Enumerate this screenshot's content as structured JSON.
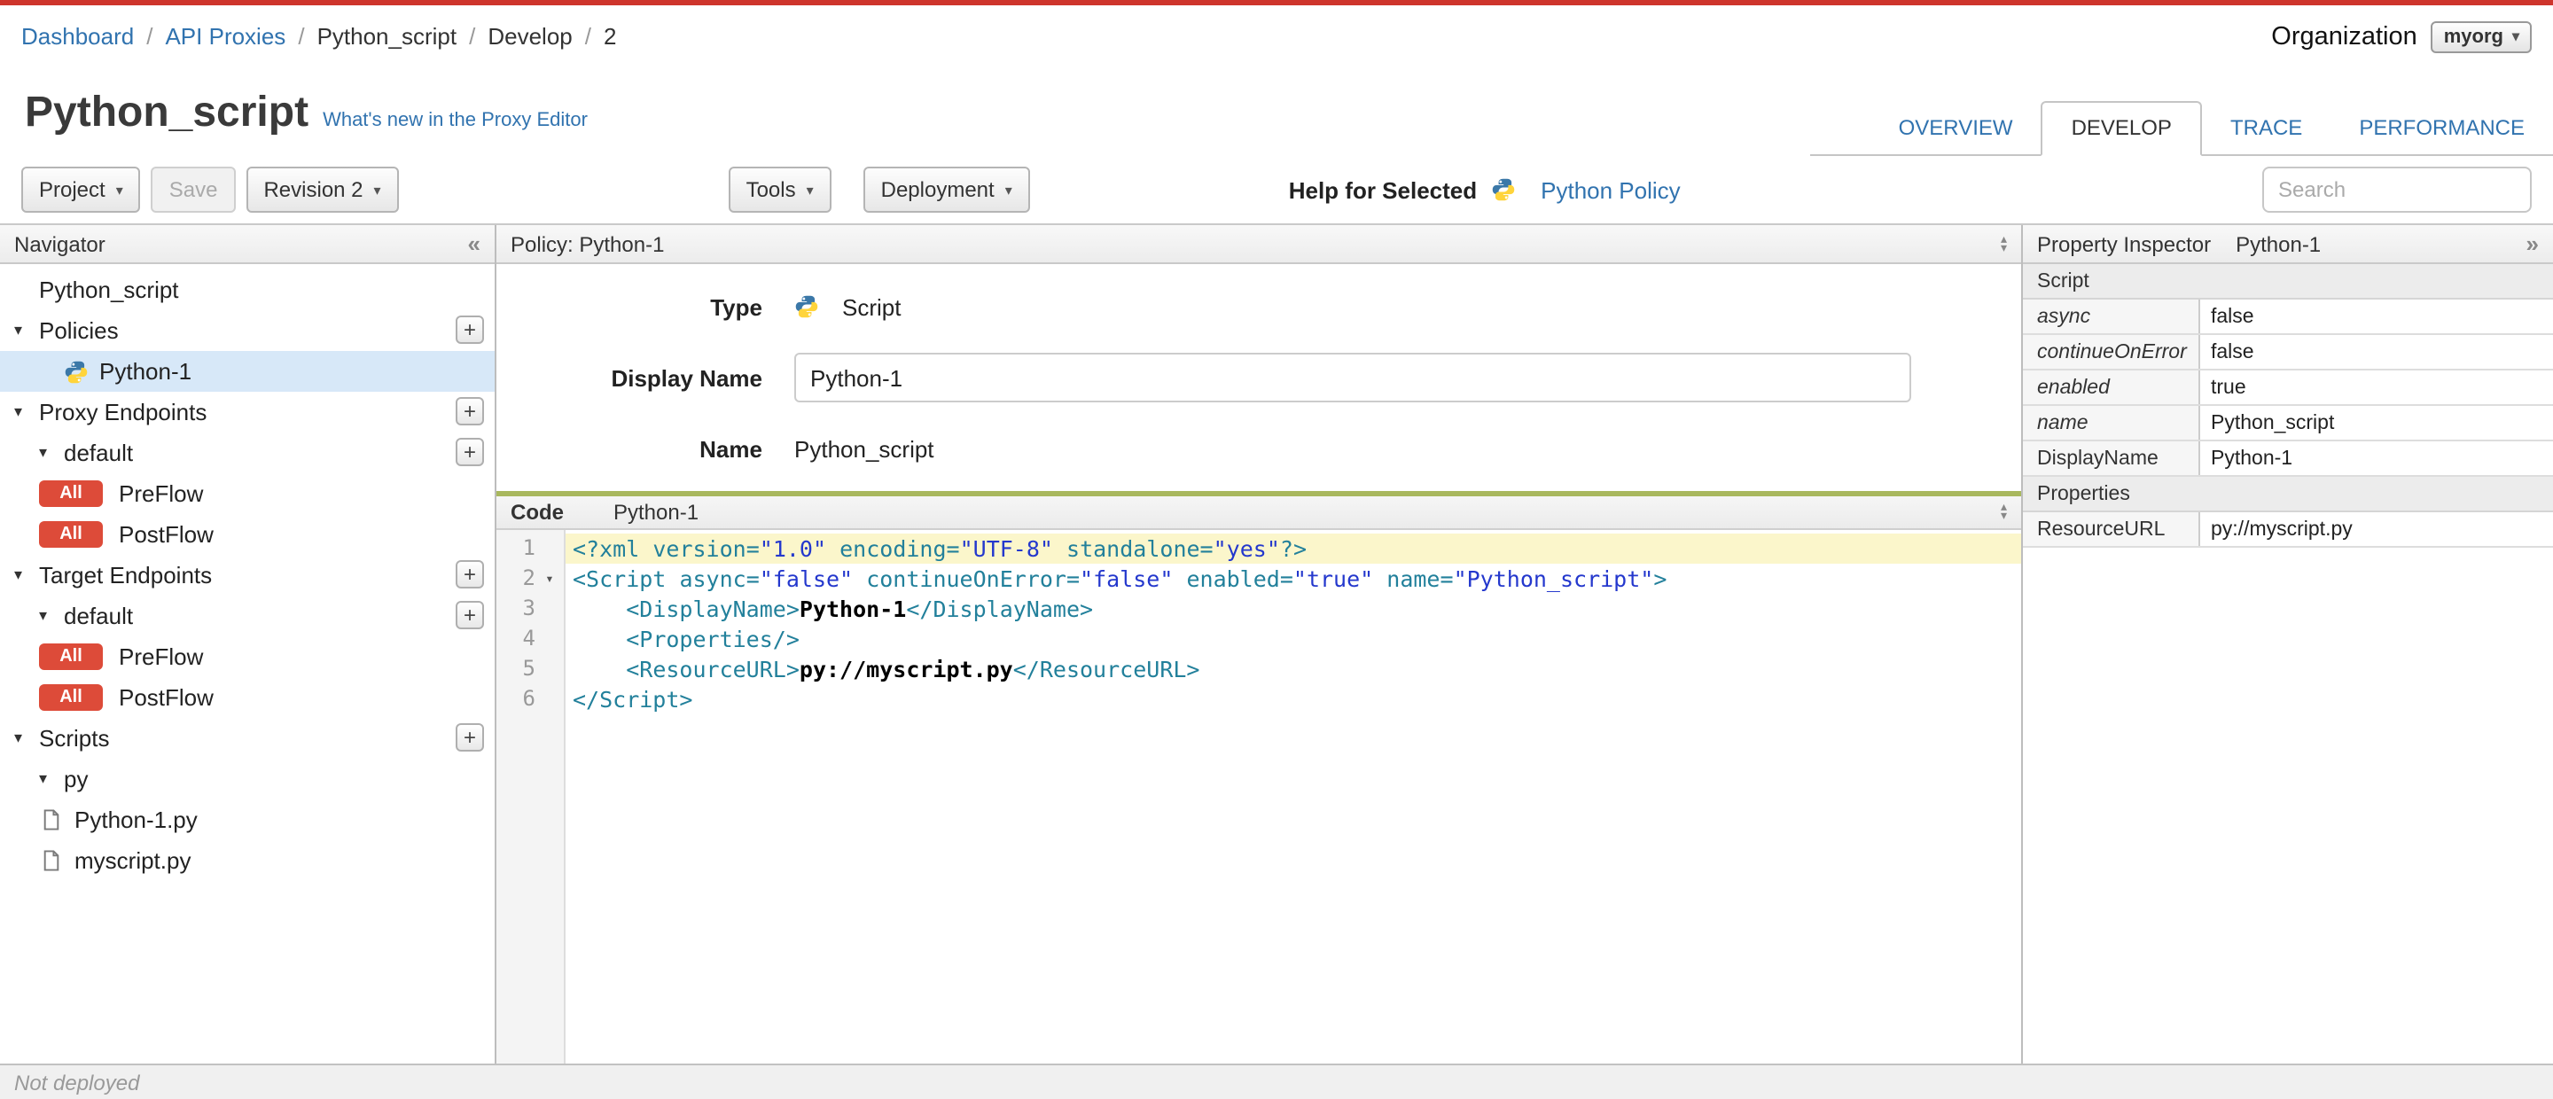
{
  "colors": {
    "accent-link": "#3173AF",
    "badge-red": "#DD4B39",
    "selected-row": "#D7E8F8",
    "code-divider-green": "#A9B85E",
    "top-stripe-red": "#CE352C",
    "active-line": "#FBF6CB",
    "tag-teal": "#22809B",
    "string-blue": "#2438CD"
  },
  "breadcrumb": {
    "items": [
      {
        "label": "Dashboard",
        "link": true
      },
      {
        "label": "API Proxies",
        "link": true
      },
      {
        "label": "Python_script",
        "link": false
      },
      {
        "label": "Develop",
        "link": false
      },
      {
        "label": "2",
        "link": false
      }
    ]
  },
  "organization": {
    "label": "Organization",
    "value": "myorg"
  },
  "header": {
    "title": "Python_script",
    "whats_new": "What's new in the Proxy Editor"
  },
  "tabs": [
    {
      "label": "OVERVIEW",
      "active": false
    },
    {
      "label": "DEVELOP",
      "active": true
    },
    {
      "label": "TRACE",
      "active": false
    },
    {
      "label": "PERFORMANCE",
      "active": false
    }
  ],
  "toolbar": {
    "project": "Project",
    "save": "Save",
    "revision": "Revision 2",
    "tools": "Tools",
    "deployment": "Deployment",
    "help_label": "Help for Selected",
    "help_link": "Python Policy",
    "search_placeholder": "Search"
  },
  "navigator": {
    "title": "Navigator",
    "collapse_icon": "«",
    "items": [
      {
        "label": "Python_script",
        "level": 0,
        "arrow": false,
        "pad": true
      },
      {
        "label": "Policies",
        "level": 0,
        "arrow": true,
        "plus": true
      },
      {
        "label": "Python-1",
        "level": 1,
        "arrow": false,
        "pad": true,
        "icon": "python",
        "selected": true
      },
      {
        "label": "Proxy Endpoints",
        "level": 0,
        "arrow": true,
        "plus": true
      },
      {
        "label": "default",
        "level": 1,
        "arrow": true,
        "plus": true
      },
      {
        "label": "PreFlow",
        "level": 1,
        "badge": "All"
      },
      {
        "label": "PostFlow",
        "level": 1,
        "badge": "All"
      },
      {
        "label": "Target Endpoints",
        "level": 0,
        "arrow": true,
        "plus": true
      },
      {
        "label": "default",
        "level": 1,
        "arrow": true,
        "plus": true
      },
      {
        "label": "PreFlow",
        "level": 1,
        "badge": "All"
      },
      {
        "label": "PostFlow",
        "level": 1,
        "badge": "All"
      },
      {
        "label": "Scripts",
        "level": 0,
        "arrow": true,
        "plus": true
      },
      {
        "label": "py",
        "level": 1,
        "arrow": true
      },
      {
        "label": "Python-1.py",
        "level": 1,
        "icon": "file"
      },
      {
        "label": "myscript.py",
        "level": 1,
        "icon": "file"
      }
    ]
  },
  "policy_panel": {
    "title": "Policy: Python-1",
    "type_label": "Type",
    "type_value": "Script",
    "display_name_label": "Display Name",
    "display_name_value": "Python-1",
    "name_label": "Name",
    "name_value": "Python_script"
  },
  "code_panel": {
    "label": "Code",
    "name": "Python-1",
    "lines": [
      {
        "num": 1,
        "active": true,
        "fold": false,
        "tokens": [
          [
            "tag",
            "<?xml"
          ],
          [
            "plain",
            " "
          ],
          [
            "attr",
            "version="
          ],
          [
            "str",
            "\"1.0\""
          ],
          [
            "plain",
            " "
          ],
          [
            "attr",
            "encoding="
          ],
          [
            "str",
            "\"UTF-8\""
          ],
          [
            "plain",
            " "
          ],
          [
            "attr",
            "standalone="
          ],
          [
            "str",
            "\"yes\""
          ],
          [
            "tag",
            "?>"
          ]
        ]
      },
      {
        "num": 2,
        "active": false,
        "fold": true,
        "tokens": [
          [
            "tag",
            "<Script"
          ],
          [
            "plain",
            " "
          ],
          [
            "attr",
            "async="
          ],
          [
            "str",
            "\"false\""
          ],
          [
            "plain",
            " "
          ],
          [
            "attr",
            "continueOnError="
          ],
          [
            "str",
            "\"false\""
          ],
          [
            "plain",
            " "
          ],
          [
            "attr",
            "enabled="
          ],
          [
            "str",
            "\"true\""
          ],
          [
            "plain",
            " "
          ],
          [
            "attr",
            "name="
          ],
          [
            "str",
            "\"Python_script\""
          ],
          [
            "tag",
            ">"
          ]
        ]
      },
      {
        "num": 3,
        "active": false,
        "fold": false,
        "tokens": [
          [
            "plain",
            "    "
          ],
          [
            "tag",
            "<DisplayName>"
          ],
          [
            "text",
            "Python-1"
          ],
          [
            "tag",
            "</DisplayName>"
          ]
        ]
      },
      {
        "num": 4,
        "active": false,
        "fold": false,
        "tokens": [
          [
            "plain",
            "    "
          ],
          [
            "tag",
            "<Properties/>"
          ]
        ]
      },
      {
        "num": 5,
        "active": false,
        "fold": false,
        "tokens": [
          [
            "plain",
            "    "
          ],
          [
            "tag",
            "<ResourceURL>"
          ],
          [
            "text",
            "py://myscript.py"
          ],
          [
            "tag",
            "</ResourceURL>"
          ]
        ]
      },
      {
        "num": 6,
        "active": false,
        "fold": false,
        "tokens": [
          [
            "tag",
            "</Script>"
          ]
        ]
      }
    ]
  },
  "property_inspector": {
    "title": "Property Inspector",
    "name": "Python-1",
    "expand_icon": "»",
    "rows": [
      {
        "section": "Script"
      },
      {
        "label": "async",
        "value": "false",
        "italic": true
      },
      {
        "label": "continueOnError",
        "value": "false",
        "italic": true
      },
      {
        "label": "enabled",
        "value": "true",
        "italic": true
      },
      {
        "label": "name",
        "value": "Python_script",
        "italic": true
      },
      {
        "label": "DisplayName",
        "value": "Python-1",
        "italic": false
      },
      {
        "section": "Properties"
      },
      {
        "label": "ResourceURL",
        "value": "py://myscript.py",
        "italic": false
      }
    ]
  },
  "status_bar": {
    "text": "Not deployed"
  }
}
